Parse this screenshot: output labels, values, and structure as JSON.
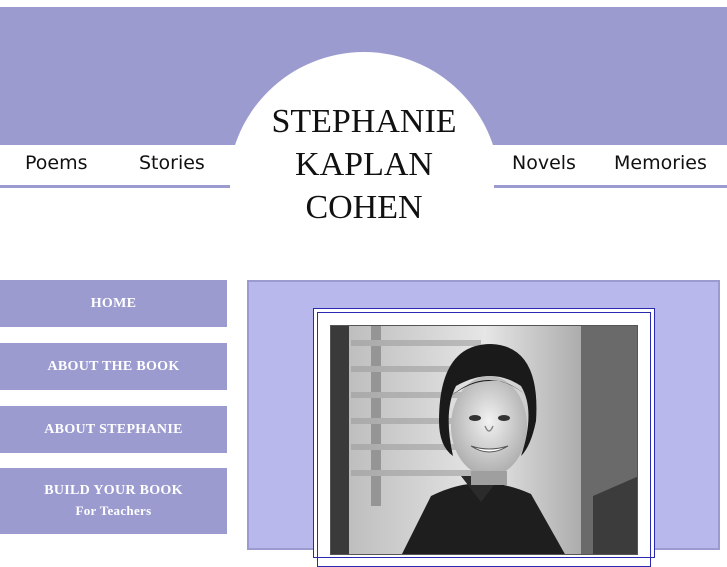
{
  "header": {
    "title_lines": [
      "STEPHANIE",
      "KAPLAN",
      "COHEN"
    ],
    "nav_left": [
      "Poems",
      "Stories"
    ],
    "nav_right": [
      "Novels",
      "Memories"
    ]
  },
  "sidebar": {
    "items": [
      {
        "label": "HOME"
      },
      {
        "label": "ABOUT THE BOOK"
      },
      {
        "label": "ABOUT STEPHANIE"
      },
      {
        "label": "BUILD YOUR BOOK",
        "sub": "For Teachers"
      }
    ]
  },
  "colors": {
    "banner": "#9b9bd0",
    "content_panel": "#b8b8ec",
    "frame_border": "#2a2ab0"
  },
  "icons": {
    "portrait": "portrait-photo"
  }
}
